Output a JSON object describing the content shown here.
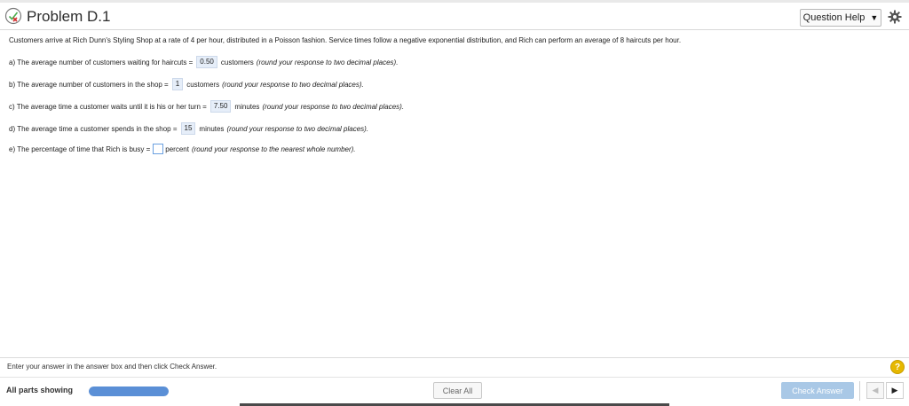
{
  "header": {
    "title": "Problem D.1",
    "question_help": "Question Help",
    "status_icon": "incorrect-icon",
    "settings_icon": "gear-icon"
  },
  "problem": {
    "intro": "Customers arrive at Rich Dunn's Styling Shop at a rate of 4 per hour, distributed in a Poisson fashion. Service times follow a negative exponential distribution, and Rich can perform an average of 8 haircuts per hour.",
    "parts": [
      {
        "prefix": "a) The average number of customers waiting for haircuts =",
        "answer": "0.50",
        "suffix": "customers",
        "hint": "(round your response to two decimal places)."
      },
      {
        "prefix": "b) The average number of customers in the shop =",
        "answer": "1",
        "suffix": "customers",
        "hint": "(round your response to two decimal places)."
      },
      {
        "prefix": "c) The average time a customer waits until it is his or her turn =",
        "answer": "7.50",
        "suffix": "minutes",
        "hint": "(round your response to two decimal places)."
      },
      {
        "prefix": "d) The average time a customer spends in the shop =",
        "answer": "15",
        "suffix": "minutes",
        "hint": "(round your response to two decimal places)."
      },
      {
        "prefix": "e) The percentage of time that Rich is busy =",
        "answer": "",
        "suffix": "percent",
        "hint": "(round your response to the nearest whole number)."
      }
    ]
  },
  "footer": {
    "instruction": "Enter your answer in the answer box and then click Check Answer.",
    "help_symbol": "?",
    "parts_label": "All parts showing",
    "progress_fraction": 1.0,
    "clear_label": "Clear All",
    "check_label": "Check Answer"
  },
  "colors": {
    "accent": "#5a8fd6",
    "check_button": "#a9c8e6",
    "answer_bg": "#e6eef9",
    "help_badge": "#e6b800"
  }
}
